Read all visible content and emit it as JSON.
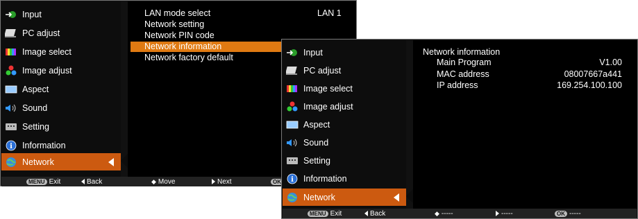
{
  "left": {
    "sidebar": [
      {
        "label": "Input",
        "icon": "input-icon"
      },
      {
        "label": "PC adjust",
        "icon": "pc-adjust-icon"
      },
      {
        "label": "Image select",
        "icon": "image-select-icon"
      },
      {
        "label": "Image adjust",
        "icon": "image-adjust-icon"
      },
      {
        "label": "Aspect",
        "icon": "aspect-icon"
      },
      {
        "label": "Sound",
        "icon": "sound-icon"
      },
      {
        "label": "Setting",
        "icon": "setting-icon"
      },
      {
        "label": "Information",
        "icon": "information-icon"
      },
      {
        "label": "Network",
        "icon": "network-icon"
      }
    ],
    "menu": [
      {
        "label": "LAN mode select",
        "value": "LAN 1"
      },
      {
        "label": "Network setting",
        "value": ""
      },
      {
        "label": "Network PIN code",
        "value": ""
      },
      {
        "label": "Network information",
        "value": ""
      },
      {
        "label": "Network factory default",
        "value": ""
      }
    ],
    "footer": {
      "exit": "Exit",
      "back": "Back",
      "move": "Move",
      "next": "Next",
      "ok": "OK",
      "menu_key": "MENU"
    }
  },
  "right": {
    "sidebar": [
      {
        "label": "Input",
        "icon": "input-icon"
      },
      {
        "label": "PC adjust",
        "icon": "pc-adjust-icon"
      },
      {
        "label": "Image select",
        "icon": "image-select-icon"
      },
      {
        "label": "Image adjust",
        "icon": "image-adjust-icon"
      },
      {
        "label": "Aspect",
        "icon": "aspect-icon"
      },
      {
        "label": "Sound",
        "icon": "sound-icon"
      },
      {
        "label": "Setting",
        "icon": "setting-icon"
      },
      {
        "label": "Information",
        "icon": "information-icon"
      },
      {
        "label": "Network",
        "icon": "network-icon"
      }
    ],
    "info": {
      "title": "Network information",
      "rows": [
        {
          "label": "Main Program",
          "value": "V1.00"
        },
        {
          "label": "MAC address",
          "value": "08007667a441"
        },
        {
          "label": "IP address",
          "value": "169.254.100.100"
        }
      ]
    },
    "footer": {
      "exit": "Exit",
      "back": "Back",
      "move": "-----",
      "next": "-----",
      "ok": "-----",
      "ok_key": "OK",
      "menu_key": "MENU"
    }
  },
  "colors": {
    "active": "#cc5a10",
    "highlight": "#e07a12",
    "background": "#000000"
  }
}
